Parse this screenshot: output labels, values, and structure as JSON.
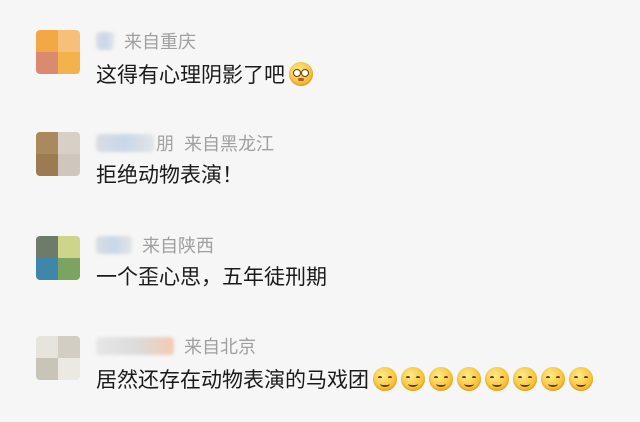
{
  "comments": [
    {
      "avatar_colors": [
        "#f2a847",
        "#f7c07a",
        "#d98a6f",
        "#f4b24d"
      ],
      "location": "来自重庆",
      "text": "这得有心理阴影了吧",
      "emojis": [
        "flushed-face"
      ]
    },
    {
      "avatar_colors": [
        "#a88a5e",
        "#d8d0c6",
        "#9c7b52",
        "#cfc7bd"
      ],
      "nickname_visible_fragment": "朋",
      "location": "来自黑龙江",
      "text": "拒绝动物表演！",
      "emojis": []
    },
    {
      "avatar_colors": [
        "#6e7b6a",
        "#cdd58a",
        "#3f86a8",
        "#7aa45f"
      ],
      "location": "来自陕西",
      "text": "一个歪心思，五年徒刑期",
      "emojis": []
    },
    {
      "avatar_colors": [
        "#e7e4dc",
        "#d2cec4",
        "#c9c4b8",
        "#ece9e2"
      ],
      "location": "来自北京",
      "text": "居然还存在动物表演的马戏团",
      "emojis": [
        "smiling-face",
        "smiling-face",
        "smiling-face",
        "smiling-face",
        "smiling-face",
        "smiling-face",
        "smiling-face",
        "smiling-face"
      ]
    }
  ]
}
